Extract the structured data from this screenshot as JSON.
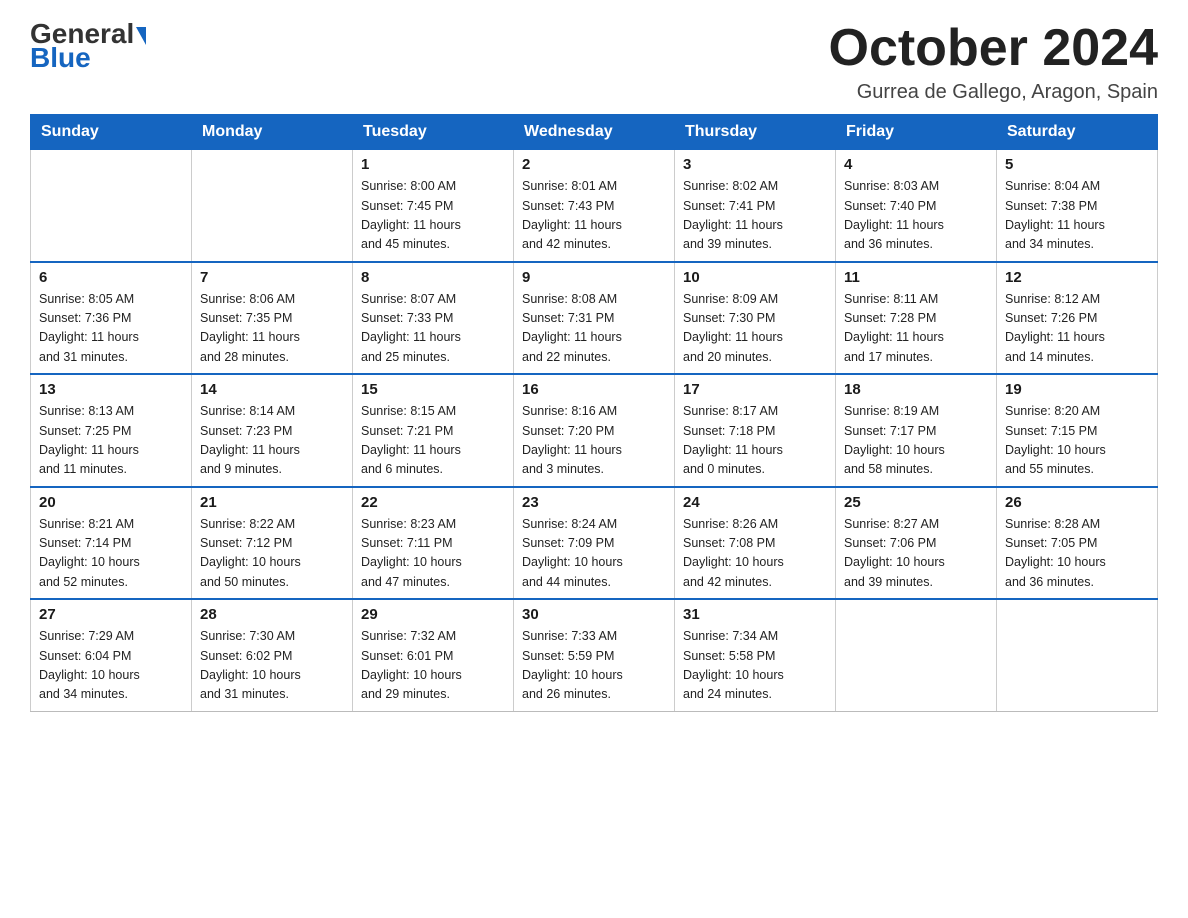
{
  "logo": {
    "general": "General",
    "blue": "Blue"
  },
  "header": {
    "title": "October 2024",
    "location": "Gurrea de Gallego, Aragon, Spain"
  },
  "weekdays": [
    "Sunday",
    "Monday",
    "Tuesday",
    "Wednesday",
    "Thursday",
    "Friday",
    "Saturday"
  ],
  "weeks": [
    [
      {
        "day": "",
        "info": ""
      },
      {
        "day": "",
        "info": ""
      },
      {
        "day": "1",
        "info": "Sunrise: 8:00 AM\nSunset: 7:45 PM\nDaylight: 11 hours\nand 45 minutes."
      },
      {
        "day": "2",
        "info": "Sunrise: 8:01 AM\nSunset: 7:43 PM\nDaylight: 11 hours\nand 42 minutes."
      },
      {
        "day": "3",
        "info": "Sunrise: 8:02 AM\nSunset: 7:41 PM\nDaylight: 11 hours\nand 39 minutes."
      },
      {
        "day": "4",
        "info": "Sunrise: 8:03 AM\nSunset: 7:40 PM\nDaylight: 11 hours\nand 36 minutes."
      },
      {
        "day": "5",
        "info": "Sunrise: 8:04 AM\nSunset: 7:38 PM\nDaylight: 11 hours\nand 34 minutes."
      }
    ],
    [
      {
        "day": "6",
        "info": "Sunrise: 8:05 AM\nSunset: 7:36 PM\nDaylight: 11 hours\nand 31 minutes."
      },
      {
        "day": "7",
        "info": "Sunrise: 8:06 AM\nSunset: 7:35 PM\nDaylight: 11 hours\nand 28 minutes."
      },
      {
        "day": "8",
        "info": "Sunrise: 8:07 AM\nSunset: 7:33 PM\nDaylight: 11 hours\nand 25 minutes."
      },
      {
        "day": "9",
        "info": "Sunrise: 8:08 AM\nSunset: 7:31 PM\nDaylight: 11 hours\nand 22 minutes."
      },
      {
        "day": "10",
        "info": "Sunrise: 8:09 AM\nSunset: 7:30 PM\nDaylight: 11 hours\nand 20 minutes."
      },
      {
        "day": "11",
        "info": "Sunrise: 8:11 AM\nSunset: 7:28 PM\nDaylight: 11 hours\nand 17 minutes."
      },
      {
        "day": "12",
        "info": "Sunrise: 8:12 AM\nSunset: 7:26 PM\nDaylight: 11 hours\nand 14 minutes."
      }
    ],
    [
      {
        "day": "13",
        "info": "Sunrise: 8:13 AM\nSunset: 7:25 PM\nDaylight: 11 hours\nand 11 minutes."
      },
      {
        "day": "14",
        "info": "Sunrise: 8:14 AM\nSunset: 7:23 PM\nDaylight: 11 hours\nand 9 minutes."
      },
      {
        "day": "15",
        "info": "Sunrise: 8:15 AM\nSunset: 7:21 PM\nDaylight: 11 hours\nand 6 minutes."
      },
      {
        "day": "16",
        "info": "Sunrise: 8:16 AM\nSunset: 7:20 PM\nDaylight: 11 hours\nand 3 minutes."
      },
      {
        "day": "17",
        "info": "Sunrise: 8:17 AM\nSunset: 7:18 PM\nDaylight: 11 hours\nand 0 minutes."
      },
      {
        "day": "18",
        "info": "Sunrise: 8:19 AM\nSunset: 7:17 PM\nDaylight: 10 hours\nand 58 minutes."
      },
      {
        "day": "19",
        "info": "Sunrise: 8:20 AM\nSunset: 7:15 PM\nDaylight: 10 hours\nand 55 minutes."
      }
    ],
    [
      {
        "day": "20",
        "info": "Sunrise: 8:21 AM\nSunset: 7:14 PM\nDaylight: 10 hours\nand 52 minutes."
      },
      {
        "day": "21",
        "info": "Sunrise: 8:22 AM\nSunset: 7:12 PM\nDaylight: 10 hours\nand 50 minutes."
      },
      {
        "day": "22",
        "info": "Sunrise: 8:23 AM\nSunset: 7:11 PM\nDaylight: 10 hours\nand 47 minutes."
      },
      {
        "day": "23",
        "info": "Sunrise: 8:24 AM\nSunset: 7:09 PM\nDaylight: 10 hours\nand 44 minutes."
      },
      {
        "day": "24",
        "info": "Sunrise: 8:26 AM\nSunset: 7:08 PM\nDaylight: 10 hours\nand 42 minutes."
      },
      {
        "day": "25",
        "info": "Sunrise: 8:27 AM\nSunset: 7:06 PM\nDaylight: 10 hours\nand 39 minutes."
      },
      {
        "day": "26",
        "info": "Sunrise: 8:28 AM\nSunset: 7:05 PM\nDaylight: 10 hours\nand 36 minutes."
      }
    ],
    [
      {
        "day": "27",
        "info": "Sunrise: 7:29 AM\nSunset: 6:04 PM\nDaylight: 10 hours\nand 34 minutes."
      },
      {
        "day": "28",
        "info": "Sunrise: 7:30 AM\nSunset: 6:02 PM\nDaylight: 10 hours\nand 31 minutes."
      },
      {
        "day": "29",
        "info": "Sunrise: 7:32 AM\nSunset: 6:01 PM\nDaylight: 10 hours\nand 29 minutes."
      },
      {
        "day": "30",
        "info": "Sunrise: 7:33 AM\nSunset: 5:59 PM\nDaylight: 10 hours\nand 26 minutes."
      },
      {
        "day": "31",
        "info": "Sunrise: 7:34 AM\nSunset: 5:58 PM\nDaylight: 10 hours\nand 24 minutes."
      },
      {
        "day": "",
        "info": ""
      },
      {
        "day": "",
        "info": ""
      }
    ]
  ]
}
